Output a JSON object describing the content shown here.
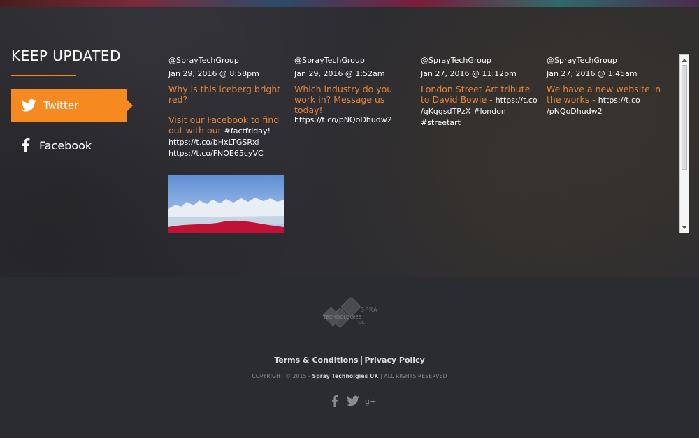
{
  "keep_updated": {
    "title": "KEEP UPDATED"
  },
  "nav": {
    "twitter_label": "Twitter",
    "facebook_label": "Facebook"
  },
  "tweets": [
    {
      "handle": "@SprayTechGroup",
      "date": "Jan 29, 2016 @ 8:58pm",
      "text": "Why is this iceberg bright red?",
      "text2_part1": "Visit our Facebook to find out with our ",
      "text2_tag": "#factfriday!",
      "text2_part2": " - ",
      "link1": "https://t.co/bHxLTGSRxi",
      "link2": "https://t.co/FNOE65cyVC",
      "image_alt": "red iceberg"
    },
    {
      "handle": "@SprayTechGroup",
      "date": "Jan 29, 2016 @ 1:52am",
      "text": "Which industry do you work in? Message us today!",
      "link": "https://t.co/pNQoDhudw2"
    },
    {
      "handle": "@SprayTechGroup",
      "date": "Jan 27, 2016 @ 11:12pm",
      "text": "London Street Art tribute to David Bowie - ",
      "link": "https://t.co /qKggsdTPzX",
      "tags": "#london #streetart"
    },
    {
      "handle": "@SprayTechGroup",
      "date": "Jan 27, 2016 @ 1:45am",
      "text": "We have a new website in the works - ",
      "link": "https://t.co /pNQoDhudw2"
    }
  ],
  "footer": {
    "logo_text_top": "SPRAY",
    "logo_text_mid": "TECHNOLOGIES",
    "logo_text_uk": "UK",
    "terms_label": "Terms & Conditions",
    "privacy_label": "Privacy Policy",
    "copyright_prefix": "COPYRIGHT © 2015 - ",
    "copyright_company": "Spray Technolgies UK",
    "copyright_suffix": " | ALL RIGHTS RESERVED"
  },
  "colors": {
    "accent": "#f68a20",
    "tweet_text": "#e8843a",
    "footer_bg": "#2b2c30"
  },
  "icons": {
    "twitter": "twitter-bird-icon",
    "facebook": "facebook-f-icon",
    "googleplus": "google-plus-icon"
  }
}
